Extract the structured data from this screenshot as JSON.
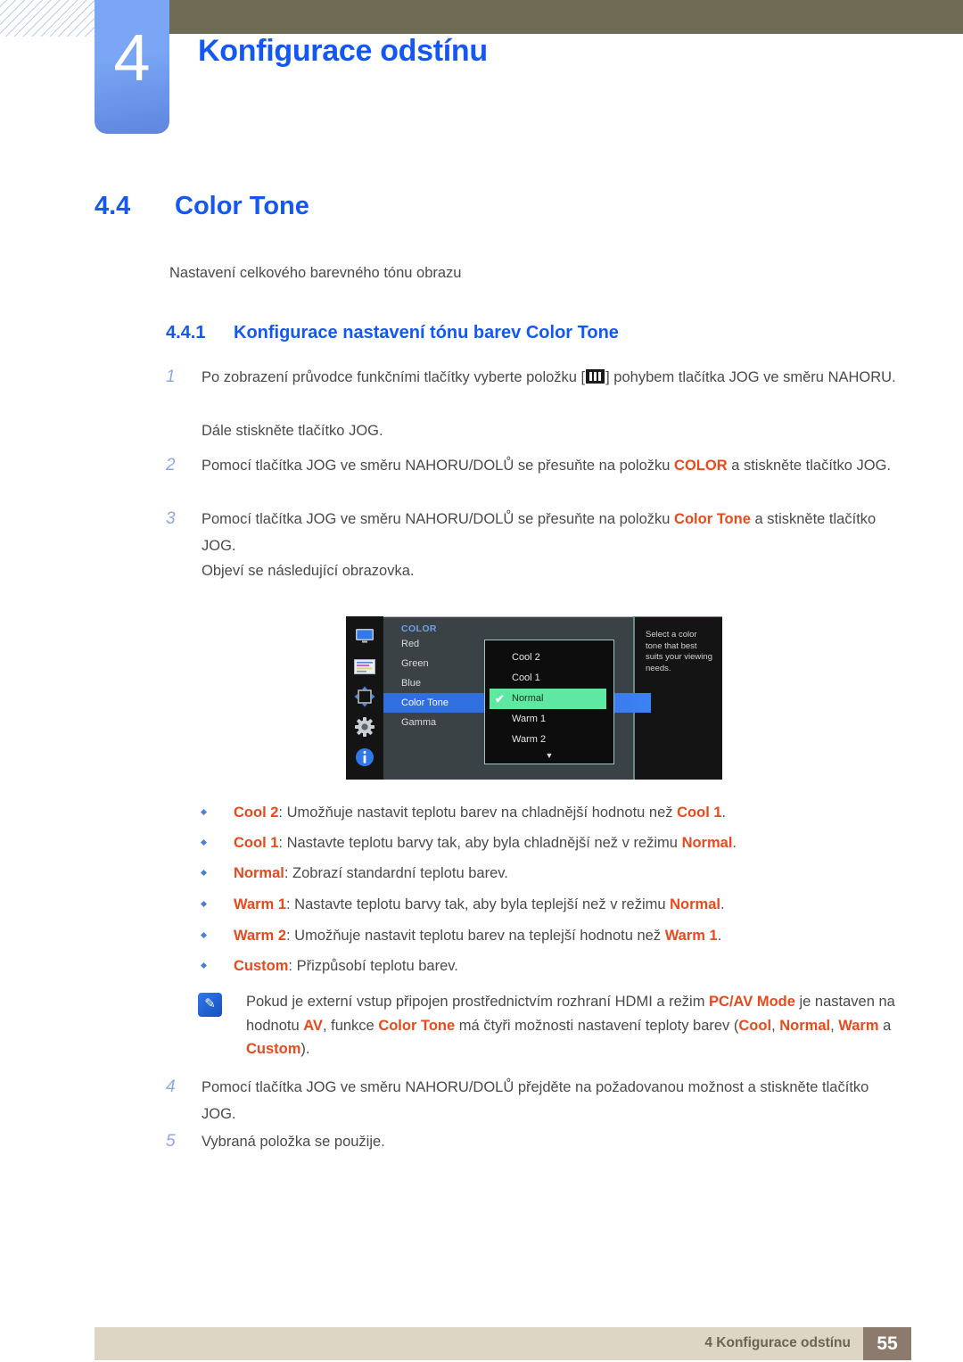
{
  "header": {
    "chapter_number": "4",
    "chapter_title": "Konfigurace odstínu"
  },
  "section": {
    "number": "4.4",
    "title": "Color Tone",
    "intro": "Nastavení celkového barevného tónu obrazu"
  },
  "subsection": {
    "number": "4.4.1",
    "title": "Konfigurace nastavení tónu barev Color Tone"
  },
  "steps": {
    "s1_num": "1",
    "s1_a": "Po zobrazení průvodce funkčními tlačítky vyberte položku [",
    "s1_b": "] pohybem tlačítka JOG ve směru NAHORU.",
    "s1_sub": "Dále stiskněte tlačítko JOG.",
    "s2_num": "2",
    "s2_a": "Pomocí tlačítka JOG ve směru NAHORU/DOLŮ se přesuňte na položku ",
    "s2_hl": "COLOR",
    "s2_b": " a stiskněte tlačítko JOG.",
    "s3_num": "3",
    "s3_a": "Pomocí tlačítka JOG ve směru NAHORU/DOLŮ se přesuňte na položku ",
    "s3_hl": "Color Tone",
    "s3_b": " a stiskněte tlačítko JOG.",
    "s3_sub": "Objeví se následující obrazovka.",
    "s4_num": "4",
    "s4_a": "Pomocí tlačítka JOG ve směru NAHORU/DOLŮ přejděte na požadovanou možnost a stiskněte tlačítko JOG.",
    "s5_num": "5",
    "s5_a": "Vybraná položka se použije."
  },
  "osd": {
    "icons": [
      "monitor-icon",
      "picture-sliders-icon",
      "resize-arrows-icon",
      "gear-icon",
      "info-icon"
    ],
    "menu_title": "COLOR",
    "menu_items": [
      "Red",
      "Green",
      "Blue",
      "Color Tone",
      "Gamma"
    ],
    "selected_menu_item": "Color Tone",
    "dropdown_items": [
      "Cool 2",
      "Cool 1",
      "Normal",
      "Warm 1",
      "Warm 2"
    ],
    "dropdown_selected": "Normal",
    "dropdown_more_icon": "▼",
    "check_icon": "✔",
    "help_text": "Select a color tone that best suits your viewing needs.",
    "colors": {
      "menu_bg": "#3b4245",
      "panel_bg": "#141414",
      "selected_row": "#2f6fe0",
      "dropdown_selected": "#5ee8a1",
      "title_blue": "#6fa0ee"
    }
  },
  "bullets": [
    {
      "term": "Cool 2",
      "a": ": Umožňuje nastavit teplotu barev na chladnější hodnotu než ",
      "term2": "Cool 1",
      "b": "."
    },
    {
      "term": "Cool 1",
      "a": ": Nastavte teplotu barvy tak, aby byla chladnější než v režimu ",
      "term2": "Normal",
      "b": "."
    },
    {
      "term": "Normal",
      "a": ": Zobrazí standardní teplotu barev.",
      "term2": "",
      "b": ""
    },
    {
      "term": "Warm 1",
      "a": ": Nastavte teplotu barvy tak, aby byla teplejší než v režimu ",
      "term2": "Normal",
      "b": "."
    },
    {
      "term": "Warm 2",
      "a": ": Umožňuje nastavit teplotu barev na teplejší hodnotu než ",
      "term2": "Warm 1",
      "b": "."
    },
    {
      "term": "Custom",
      "a": ": Přizpůsobí teplotu barev.",
      "term2": "",
      "b": ""
    }
  ],
  "note": {
    "icon": "note-pen-icon",
    "p1": "Pokud je externí vstup připojen prostřednictvím rozhraní HDMI a režim ",
    "hl1": "PC/AV Mode",
    "p2": " je nastaven na hodnotu ",
    "hl2": "AV",
    "p3": ", funkce ",
    "hl3": "Color Tone",
    "p4": " má čtyři možnosti nastavení teploty barev (",
    "hl4": "Cool",
    "p5": ", ",
    "hl5": "Normal",
    "p6": ", ",
    "hl6": "Warm",
    "p7": " a ",
    "hl7": "Custom",
    "p8": ")."
  },
  "footer": {
    "text": "4 Konfigurace odstínu",
    "page": "55"
  }
}
